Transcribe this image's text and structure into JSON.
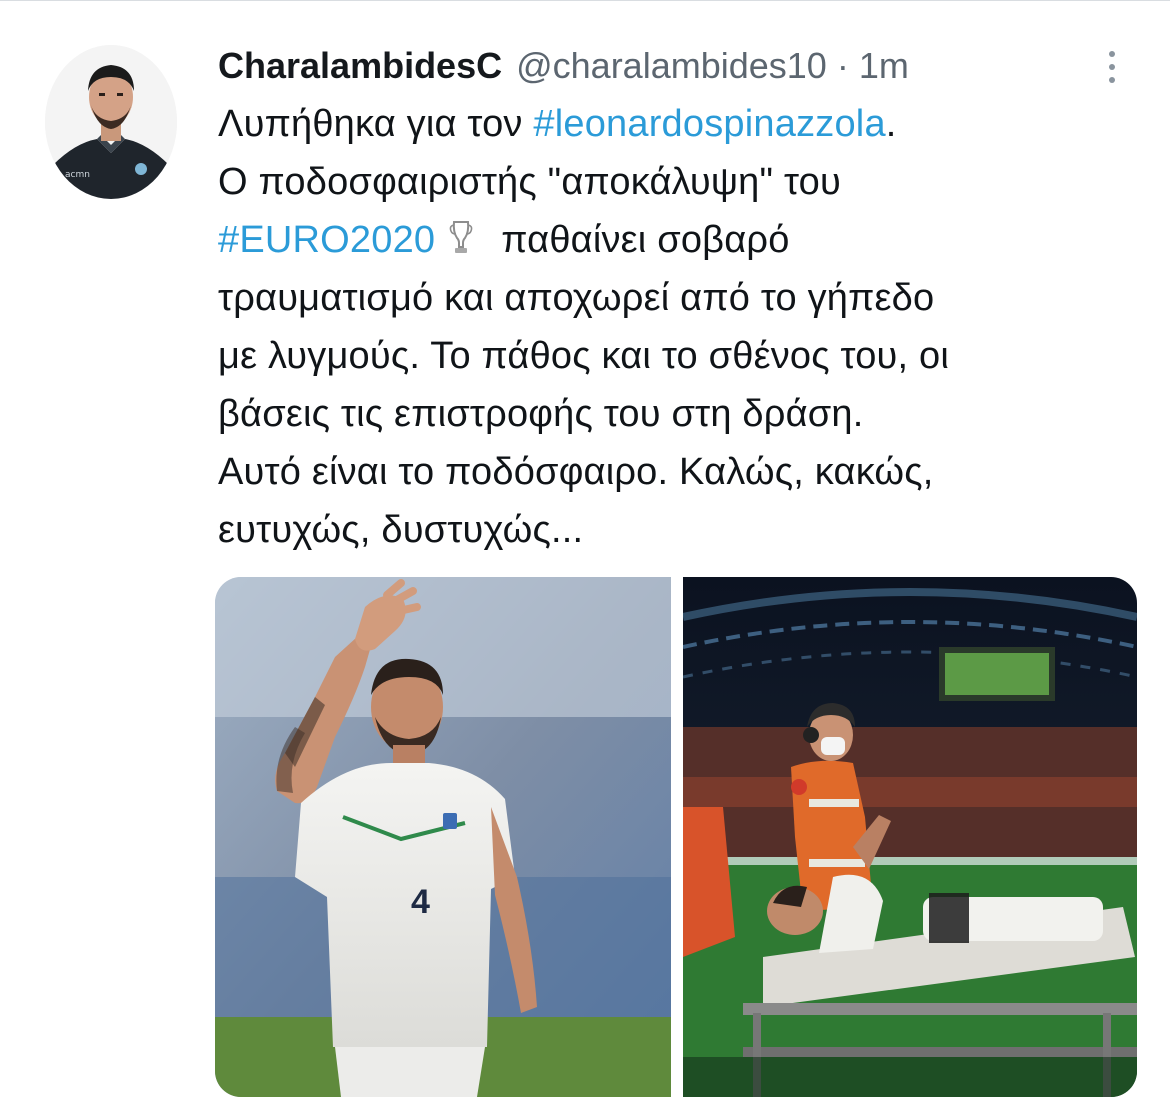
{
  "tweet": {
    "display_name": "CharalambidesC",
    "handle": "@charalambides10",
    "separator": "·",
    "time": "1m",
    "avatar_icon": "user-avatar-photo",
    "more_icon": "more-vertical-icon",
    "body": {
      "line1_text": "Λυπήθηκα για τον ",
      "line1_hashtag": "#leonardospinazzola",
      "line1_end": ".",
      "line2": "Ο ποδοσφαιριστής \"αποκάλυψη\" του",
      "line3_hashtag": "#EURO2020",
      "line3_emoji": "trophy-icon",
      "line3_text": "παθαίνει σοβαρό",
      "line4": "τραυματισμό και αποχωρεί από το γήπεδο",
      "line5": "με λυγμούς.  Το πάθος και το σθένος του, οι",
      "line6": "βάσεις τις επιστροφής του στη δράση.",
      "line7": "Αυτό είναι το ποδόσφαιρο. Καλώς, κακώς,",
      "line8": "ευτυχώς, δυστυχώς..."
    },
    "media": {
      "photo_left": {
        "icon": "player-waving-photo",
        "shirt_number": "4"
      },
      "photo_right": {
        "icon": "stretcher-stadium-photo"
      }
    }
  },
  "colors": {
    "text": "#101418",
    "muted": "#5c6670",
    "hashtag": "#2b9bd8",
    "divider": "#d9dde1"
  }
}
